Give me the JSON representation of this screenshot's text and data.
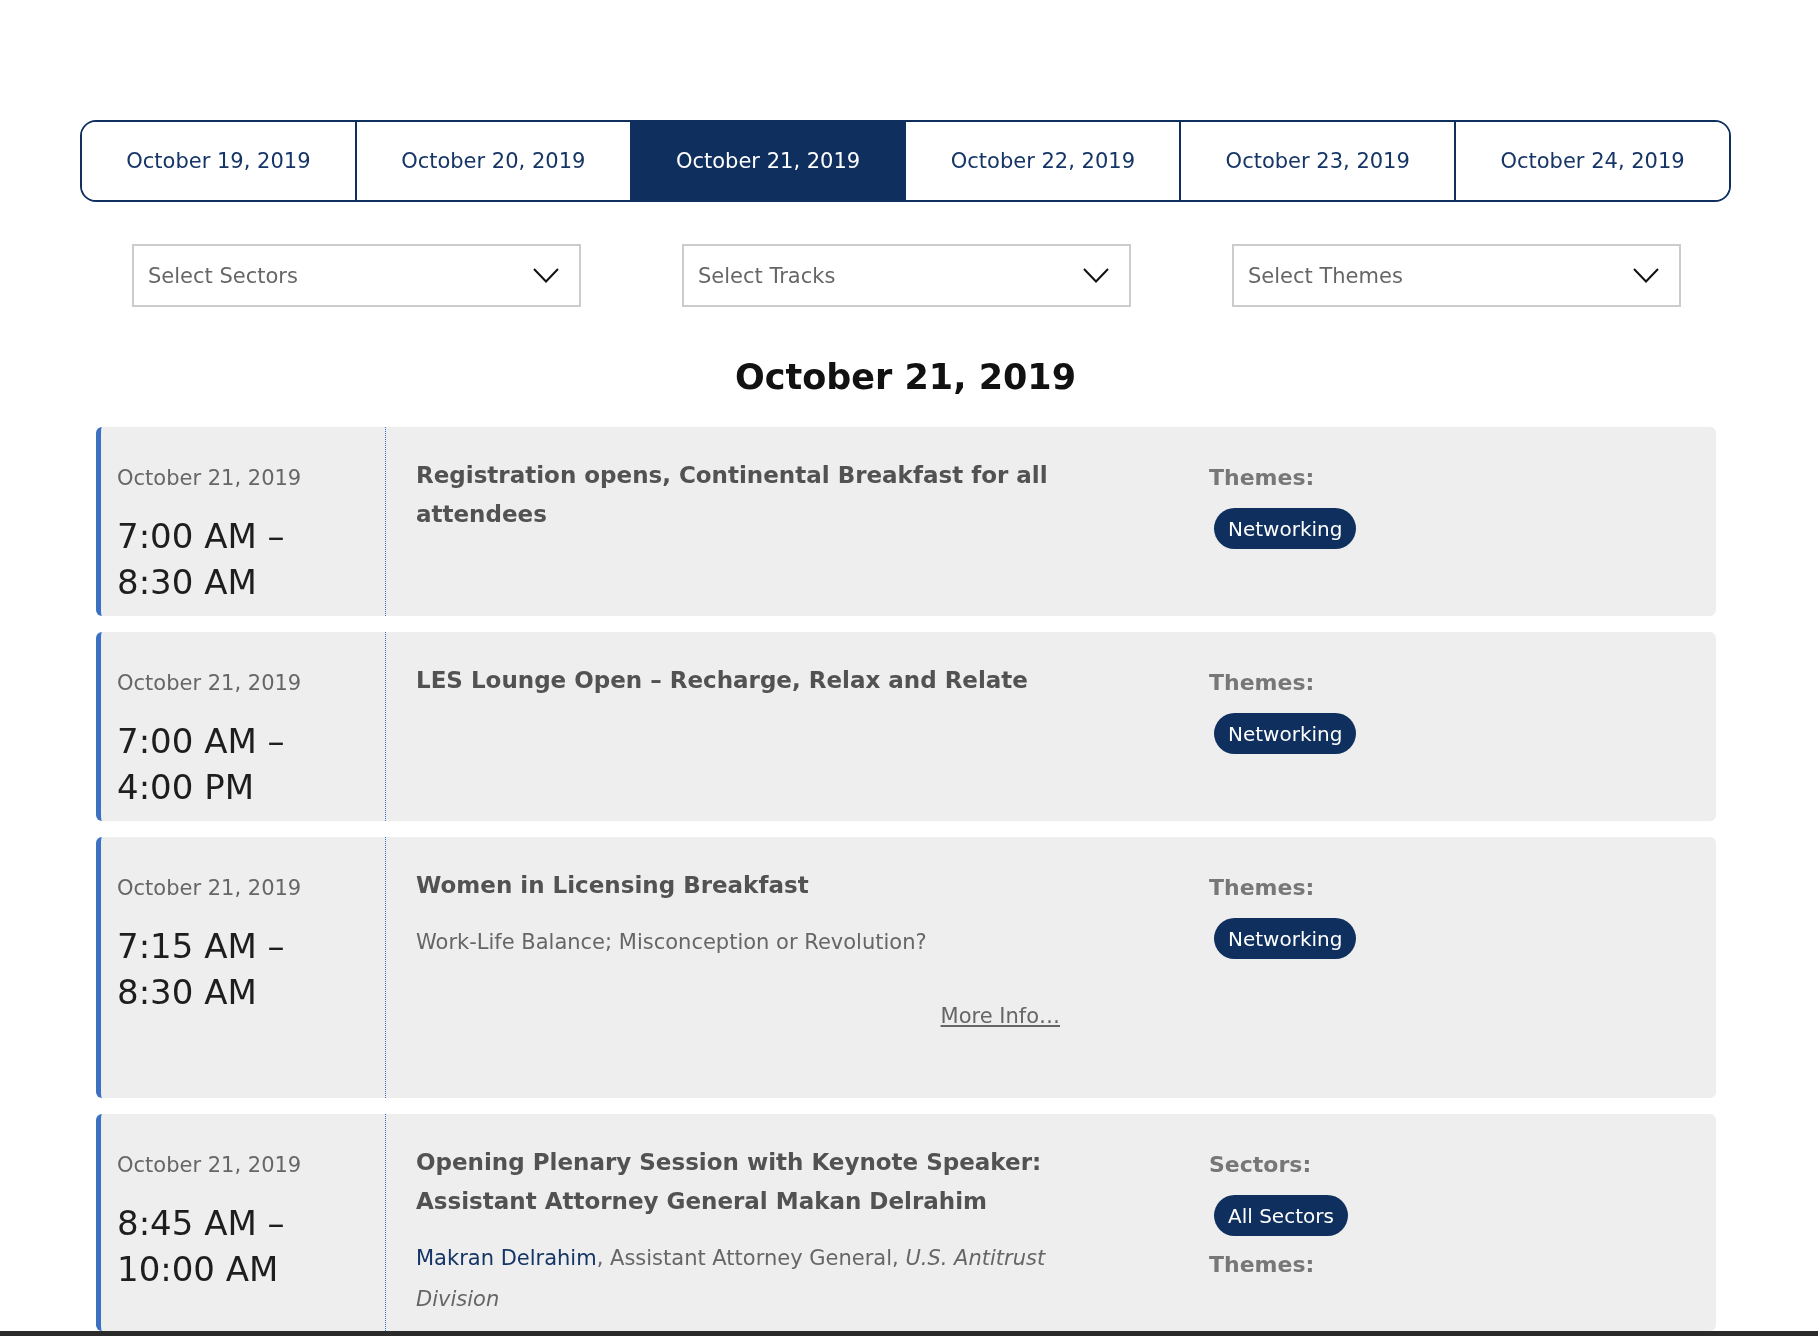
{
  "date_tabs": [
    {
      "label": "October 19, 2019",
      "selected": false
    },
    {
      "label": "October 20, 2019",
      "selected": false
    },
    {
      "label": "October 21, 2019",
      "selected": true
    },
    {
      "label": "October 22, 2019",
      "selected": false
    },
    {
      "label": "October 23, 2019",
      "selected": false
    },
    {
      "label": "October 24, 2019",
      "selected": false
    }
  ],
  "filters": [
    {
      "placeholder": "Select Sectors"
    },
    {
      "placeholder": "Select Tracks"
    },
    {
      "placeholder": "Select Themes"
    }
  ],
  "day_heading": "October 21, 2019",
  "sessions": [
    {
      "date": "October 21, 2019",
      "time": "7:00 AM – 8:30 AM",
      "title": "Registration opens, Continental Breakfast for all attendees",
      "groups": [
        {
          "label": "Themes:",
          "tags": [
            "Networking"
          ]
        }
      ]
    },
    {
      "date": "October 21, 2019",
      "time": "7:00 AM – 4:00 PM",
      "title": "LES Lounge Open – Recharge, Relax and Relate",
      "groups": [
        {
          "label": "Themes:",
          "tags": [
            "Networking"
          ]
        }
      ]
    },
    {
      "date": "October 21, 2019",
      "time": "7:15 AM – 8:30 AM",
      "title": "Women in Licensing Breakfast",
      "subtitle": "Work-Life Balance; Misconception or Revolution?",
      "more_link": "More Info…",
      "groups": [
        {
          "label": "Themes:",
          "tags": [
            "Networking"
          ]
        }
      ]
    },
    {
      "date": "October 21, 2019",
      "time": "8:45 AM – 10:00 AM",
      "title": "Opening Plenary Session with Keynote Speaker: Assistant Attorney General Makan Delrahim",
      "speakers": [
        {
          "name": "Makran Delrahim",
          "details": ", Assistant Attorney General, *U.S. Antitrust Division*"
        }
      ],
      "groups": [
        {
          "label": "Sectors:",
          "tags": [
            "All Sectors"
          ]
        },
        {
          "label": "Themes:"
        }
      ]
    }
  ]
}
